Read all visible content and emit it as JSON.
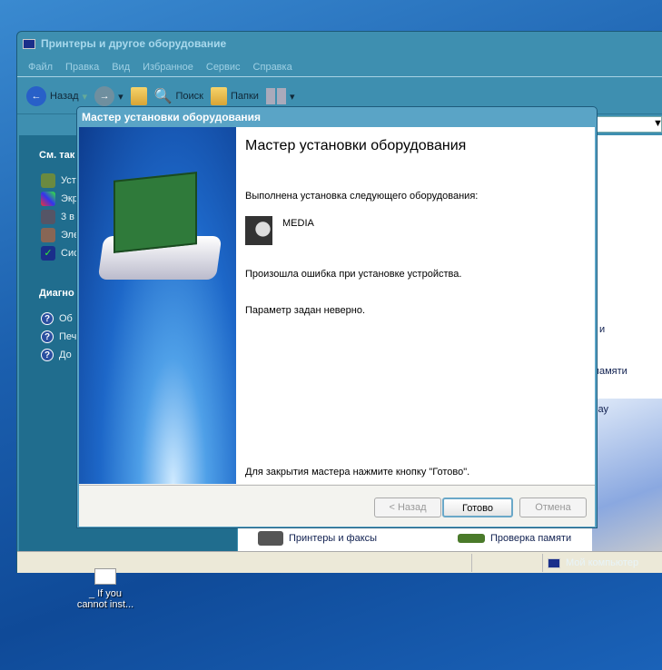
{
  "explorer": {
    "title": "Принтеры и другое оборудование",
    "menu": [
      "Файл",
      "Правка",
      "Вид",
      "Избранное",
      "Сервис",
      "Справка"
    ],
    "toolbar": {
      "back": "Назад",
      "search": "Поиск",
      "folders": "Папки"
    },
    "left_pane": {
      "see_also": "См. так",
      "see_also_items": [
        "Уст",
        "Экр",
        "3 в",
        "Эле",
        "Сис"
      ],
      "diagnostics": "Диагно",
      "diag_items": [
        "Об",
        "Печ",
        "До"
      ]
    },
    "content": {
      "items": [
        "Принтеры и факсы",
        "Проверка памяти"
      ],
      "partial": [
        "и",
        "памяти",
        "lay"
      ]
    },
    "status": {
      "computer": "Мой компьютер"
    }
  },
  "dialog": {
    "title": "Мастер установки оборудования",
    "heading": "Мастер установки оборудования",
    "installed_label": "Выполнена установка следующего оборудования:",
    "device": "MEDIA",
    "error": "Произошла ошибка при установке устройства.",
    "error_detail": "Параметр задан неверно.",
    "close_hint": "Для закрытия мастера нажмите кнопку \"Готово\".",
    "buttons": {
      "back": "< Назад",
      "finish": "Готово",
      "cancel": "Отмена"
    }
  },
  "desktop": {
    "icon_label": "_ If you cannot inst..."
  }
}
